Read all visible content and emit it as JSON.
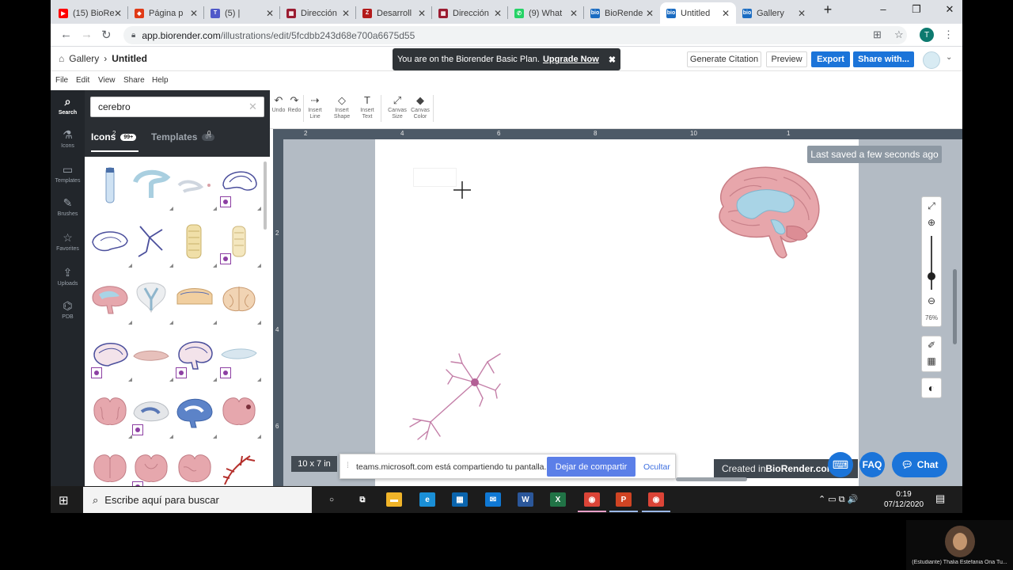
{
  "browser": {
    "tabs": [
      {
        "title": "(15) BioRe",
        "favicon_color": "#ff0000",
        "favicon_glyph": "▶",
        "icon": "youtube-icon"
      },
      {
        "title": "Página p",
        "favicon_color": "#e03a16",
        "favicon_glyph": "◆",
        "icon": "office-icon"
      },
      {
        "title": "(5) | ",
        "favicon_color": "#5059c9",
        "favicon_glyph": "T",
        "icon": "teams-icon"
      },
      {
        "title": "Dirección",
        "favicon_color": "#9b1c31",
        "favicon_glyph": "▦",
        "icon": "doc-icon"
      },
      {
        "title": "Desarroll",
        "favicon_color": "#b31b1b",
        "favicon_glyph": "Z",
        "icon": "zotero-icon"
      },
      {
        "title": "Dirección",
        "favicon_color": "#9b1c31",
        "favicon_glyph": "▦",
        "icon": "doc-icon"
      },
      {
        "title": "(9) What",
        "favicon_color": "#25d366",
        "favicon_glyph": "✆",
        "icon": "whatsapp-icon"
      },
      {
        "title": "BioRende",
        "favicon_color": "#1b6cc2",
        "favicon_glyph": "bio",
        "icon": "biorender-icon"
      },
      {
        "title": "Untitled",
        "favicon_color": "#1b6cc2",
        "favicon_glyph": "bio",
        "icon": "biorender-icon",
        "active": true
      },
      {
        "title": "Gallery",
        "favicon_color": "#1b6cc2",
        "favicon_glyph": "bio",
        "icon": "biorender-icon"
      }
    ],
    "new_tab": "+",
    "window_controls": [
      "–",
      "❐",
      "✕"
    ],
    "url_host": "app.biorender.com",
    "url_path": "/illustrations/edit/5fcdbb243d68e700a6675d55",
    "profile_initial": "T"
  },
  "app": {
    "breadcrumb": {
      "gallery": "Gallery",
      "separator": "›",
      "title": "Untitled"
    },
    "banner": {
      "text": "You are on the Biorender Basic Plan.",
      "link": "Upgrade Now",
      "close": "✖"
    },
    "buttons": {
      "generate_citation": "Generate Citation",
      "preview": "Preview",
      "export": "Export",
      "share": "Share with..."
    },
    "menu": [
      "File",
      "Edit",
      "View",
      "Share",
      "Help"
    ],
    "rail": [
      {
        "label": "Search",
        "glyph": "⌕",
        "active": true
      },
      {
        "label": "Icons",
        "glyph": "⚗"
      },
      {
        "label": "Templates",
        "glyph": "▭"
      },
      {
        "label": "Brushes",
        "glyph": "✎"
      },
      {
        "label": "Favorites",
        "glyph": "☆"
      },
      {
        "label": "Uploads",
        "glyph": "⇪"
      },
      {
        "label": "PDB",
        "glyph": "⌬"
      }
    ],
    "search": {
      "value": "cerebro",
      "clear": "✕"
    },
    "panel_tabs": {
      "icons": "Icons",
      "icons_count": "99+",
      "templates": "Templates",
      "templates_count": "0+"
    },
    "toolbar": [
      {
        "label": "Undo",
        "glyph": "↶"
      },
      {
        "label": "Redo",
        "glyph": "↷"
      },
      {
        "label": "Insert Line",
        "glyph": "⇢"
      },
      {
        "label": "Insert Shape",
        "glyph": "◇"
      },
      {
        "label": "Insert Text",
        "glyph": "T"
      },
      {
        "label": "Canvas Size",
        "glyph": "⤢"
      },
      {
        "label": "Canvas Color",
        "glyph": "◆"
      }
    ],
    "ruler_top": [
      "2",
      "0",
      "2",
      "4",
      "6",
      "8",
      "10",
      "1"
    ],
    "ruler_left": [
      "2",
      "4",
      "6"
    ],
    "last_saved": "Last saved a few seconds ago",
    "zoom_level": "76%",
    "zoom_fraction": 0.75,
    "canvas_size": "10 x 7 in",
    "created_in": {
      "prefix": "Created in ",
      "brand": "BioRender.com"
    },
    "help": {
      "keyboard": "⌨",
      "faq": "FAQ",
      "chat": "Chat"
    },
    "pro_badge_count": 10
  },
  "screen_share": {
    "message": "teams.microsoft.com está compartiendo tu pantalla.",
    "stop": "Dejar de compartir",
    "hide": "Ocultar"
  },
  "taskbar": {
    "search_placeholder": "Escribe aquí para buscar",
    "time": "0:19",
    "date": "07/12/2020",
    "apps": [
      {
        "name": "cortana",
        "glyph": "○",
        "color": "transparent"
      },
      {
        "name": "task-view",
        "glyph": "⧉",
        "color": "transparent"
      },
      {
        "name": "file-explorer",
        "glyph": "▬",
        "color": "#f0b429"
      },
      {
        "name": "edge",
        "glyph": "e",
        "color": "#1a8fd6"
      },
      {
        "name": "store",
        "glyph": "▦",
        "color": "#0a64ad"
      },
      {
        "name": "mail",
        "glyph": "✉",
        "color": "#0f78d4"
      },
      {
        "name": "word",
        "glyph": "W",
        "color": "#2b579a"
      },
      {
        "name": "excel",
        "glyph": "X",
        "color": "#217346"
      },
      {
        "name": "chrome",
        "glyph": "◉",
        "color": "#db4437"
      },
      {
        "name": "powerpoint",
        "glyph": "P",
        "color": "#d04423"
      },
      {
        "name": "chrome-2",
        "glyph": "◉",
        "color": "#db4437"
      }
    ],
    "tray": "⌃  ▭  ⧉  🔊"
  },
  "presenter": {
    "name": "(Estudiante) Thalia Estefania Ona Tu..."
  }
}
